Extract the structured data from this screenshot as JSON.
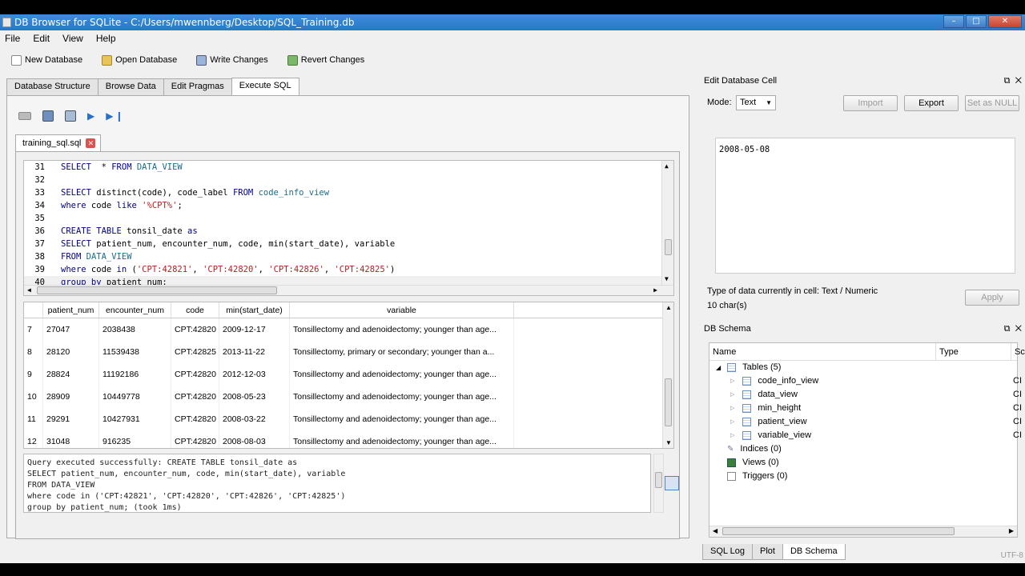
{
  "window": {
    "title": "DB Browser for SQLite - C:/Users/mwennberg/Desktop/SQL_Training.db"
  },
  "menu": [
    "File",
    "Edit",
    "View",
    "Help"
  ],
  "toolbar": {
    "new_db": "New Database",
    "open_db": "Open Database",
    "write": "Write Changes",
    "revert": "Revert Changes"
  },
  "tabs": [
    "Database Structure",
    "Browse Data",
    "Edit Pragmas",
    "Execute SQL"
  ],
  "active_tab": "Execute SQL",
  "file_tab": "training_sql.sql",
  "editor_lines": [
    {
      "n": "31",
      "parts": [
        [
          "kw",
          "SELECT"
        ],
        [
          "",
          "  * "
        ],
        [
          "kw",
          "FROM"
        ],
        [
          "",
          " "
        ],
        [
          "ident",
          "DATA_VIEW"
        ]
      ]
    },
    {
      "n": "32",
      "parts": []
    },
    {
      "n": "33",
      "parts": [
        [
          "kw",
          "SELECT"
        ],
        [
          "",
          " distinct(code), code_label "
        ],
        [
          "kw",
          "FROM"
        ],
        [
          "",
          " "
        ],
        [
          "ident",
          "code_info_view"
        ]
      ]
    },
    {
      "n": "34",
      "parts": [
        [
          "kw",
          "where"
        ],
        [
          "",
          " code "
        ],
        [
          "kw",
          "like"
        ],
        [
          "",
          " "
        ],
        [
          "str",
          "'%CPT%'"
        ],
        [
          "",
          ";"
        ]
      ]
    },
    {
      "n": "35",
      "parts": []
    },
    {
      "n": "36",
      "parts": [
        [
          "kw",
          "CREATE TABLE"
        ],
        [
          "",
          " tonsil_date "
        ],
        [
          "kw",
          "as"
        ]
      ]
    },
    {
      "n": "37",
      "parts": [
        [
          "kw",
          "SELECT"
        ],
        [
          "",
          " patient_num, encounter_num, code, min(start_date), variable"
        ]
      ]
    },
    {
      "n": "38",
      "parts": [
        [
          "kw",
          "FROM"
        ],
        [
          "",
          " "
        ],
        [
          "ident",
          "DATA_VIEW"
        ]
      ]
    },
    {
      "n": "39",
      "parts": [
        [
          "kw",
          "where"
        ],
        [
          "",
          " code "
        ],
        [
          "kw",
          "in"
        ],
        [
          "",
          " ("
        ],
        [
          "str",
          "'CPT:42821'"
        ],
        [
          "",
          ", "
        ],
        [
          "str",
          "'CPT:42820'"
        ],
        [
          "",
          ", "
        ],
        [
          "str",
          "'CPT:42826'"
        ],
        [
          "",
          ", "
        ],
        [
          "str",
          "'CPT:42825'"
        ],
        [
          "",
          ")"
        ]
      ]
    },
    {
      "n": "40",
      "parts": [
        [
          "kw",
          "group by"
        ],
        [
          "",
          " patient_num;"
        ]
      ]
    }
  ],
  "results": {
    "columns": [
      "patient_num",
      "encounter_num",
      "code",
      "min(start_date)",
      "variable"
    ],
    "rows": [
      [
        "7",
        "27047",
        "2038438",
        "CPT:42820",
        "2009-12-17",
        "Tonsillectomy and adenoidectomy; younger than age..."
      ],
      [
        "8",
        "28120",
        "11539438",
        "CPT:42825",
        "2013-11-22",
        "Tonsillectomy, primary or secondary; younger than a..."
      ],
      [
        "9",
        "28824",
        "11192186",
        "CPT:42820",
        "2012-12-03",
        "Tonsillectomy and adenoidectomy; younger than age..."
      ],
      [
        "10",
        "28909",
        "10449778",
        "CPT:42820",
        "2008-05-23",
        "Tonsillectomy and adenoidectomy; younger than age..."
      ],
      [
        "11",
        "29291",
        "10427931",
        "CPT:42820",
        "2008-03-22",
        "Tonsillectomy and adenoidectomy; younger than age..."
      ],
      [
        "12",
        "31048",
        "916235",
        "CPT:42820",
        "2008-08-03",
        "Tonsillectomy and adenoidectomy; younger than age..."
      ]
    ]
  },
  "message": "Query executed successfully: CREATE TABLE tonsil_date as\nSELECT patient_num, encounter_num, code, min(start_date), variable\nFROM DATA_VIEW\nwhere code in ('CPT:42821', 'CPT:42820', 'CPT:42826', 'CPT:42825')\ngroup by patient_num; (took 1ms)",
  "edit_cell": {
    "title": "Edit Database Cell",
    "mode_label": "Mode:",
    "mode_value": "Text",
    "import": "Import",
    "export": "Export",
    "set_null": "Set as NULL",
    "value": "2008-05-08",
    "type_info": "Type of data currently in cell: Text / Numeric",
    "size_info": "10 char(s)",
    "apply": "Apply"
  },
  "schema": {
    "title": "DB Schema",
    "col_name": "Name",
    "col_type": "Type",
    "col_schema": "Sc",
    "tables_label": "Tables (5)",
    "tables": [
      "code_info_view",
      "data_view",
      "min_height",
      "patient_view",
      "variable_view"
    ],
    "cr": "CI",
    "indices": "Indices (0)",
    "views": "Views (0)",
    "triggers": "Triggers (0)"
  },
  "bottom_tabs": [
    "SQL Log",
    "Plot",
    "DB Schema"
  ],
  "status": {
    "encoding": "UTF-8"
  }
}
